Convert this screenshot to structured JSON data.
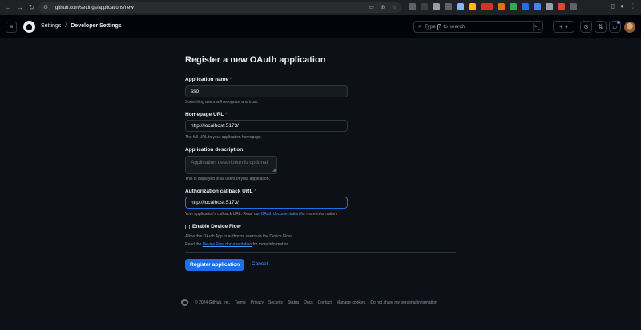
{
  "browser": {
    "url": "github.com/settings/applications/new",
    "nav_back": "←",
    "nav_forward": "→",
    "reload": "↻"
  },
  "header": {
    "breadcrumb": [
      "Settings",
      "/",
      "Developer Settings"
    ],
    "search_prefix": "Type",
    "search_key": "/",
    "search_suffix": "to search",
    "command_palette": ">_",
    "create_new": "+ ▾"
  },
  "form": {
    "title": "Register a new OAuth application",
    "app_name": {
      "label": "Application name",
      "required": "*",
      "value": "sso",
      "hint": "Something users will recognize and trust."
    },
    "homepage_url": {
      "label": "Homepage URL",
      "required": "*",
      "value": "http://localhost:5173/",
      "hint": "The full URL to your application homepage."
    },
    "description": {
      "label": "Application description",
      "placeholder": "Application description is optional",
      "hint": "This is displayed to all users of your application."
    },
    "callback_url": {
      "label": "Authorization callback URL",
      "required": "*",
      "value": "http://localhost:5173/",
      "hint_before": "Your application's callback URL. Read our",
      "hint_link": "OAuth documentation",
      "hint_after": "for more information."
    },
    "device_flow": {
      "label": "Enable Device Flow",
      "checked": false,
      "hint": "Allow this OAuth App to authorize users via the Device Flow.",
      "hint2_before": "Read the",
      "hint2_link": "Device Flow documentation",
      "hint2_after": "for more information."
    },
    "submit_label": "Register application",
    "cancel_label": "Cancel"
  },
  "footer": {
    "copyright": "© 2024 GitHub, Inc.",
    "links": [
      "Terms",
      "Privacy",
      "Security",
      "Status",
      "Docs",
      "Contact",
      "Manage cookies",
      "Do not share my personal information"
    ]
  },
  "colors": {
    "background": "#0d1117",
    "header": "#010409",
    "primary_button": "#1f6feb",
    "link": "#4493f8",
    "required": "#f85149"
  }
}
